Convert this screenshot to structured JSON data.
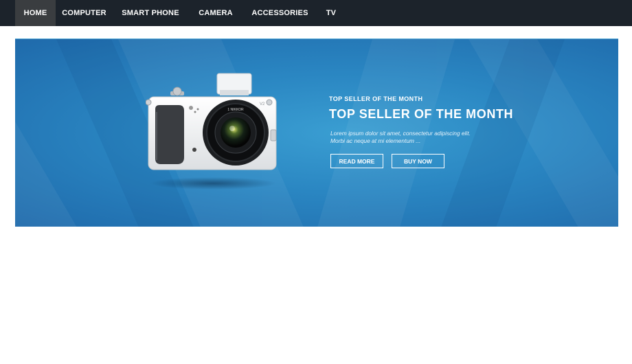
{
  "nav": {
    "items": [
      {
        "label": "HOME",
        "active": true
      },
      {
        "label": "COMPUTER",
        "active": false
      },
      {
        "label": "SMART PHONE",
        "active": false
      },
      {
        "label": "CAMERA",
        "active": false
      },
      {
        "label": "ACCESSORIES",
        "active": false
      },
      {
        "label": "TV",
        "active": false
      }
    ]
  },
  "banner": {
    "kicker": "TOP SELLER OF THE MONTH",
    "headline": "TOP SELLER OF THE MONTH",
    "description": "Lorem ipsum dolor sit amet, consectetur adipiscing elit. Morbi ac neque at mi elementum ...",
    "read_more_label": "READ MORE",
    "buy_now_label": "BUY NOW",
    "product_image": "camera-icon",
    "lens_text": "1 NIKKOR",
    "model_text": "V2",
    "background_color": "#2a86c2"
  }
}
